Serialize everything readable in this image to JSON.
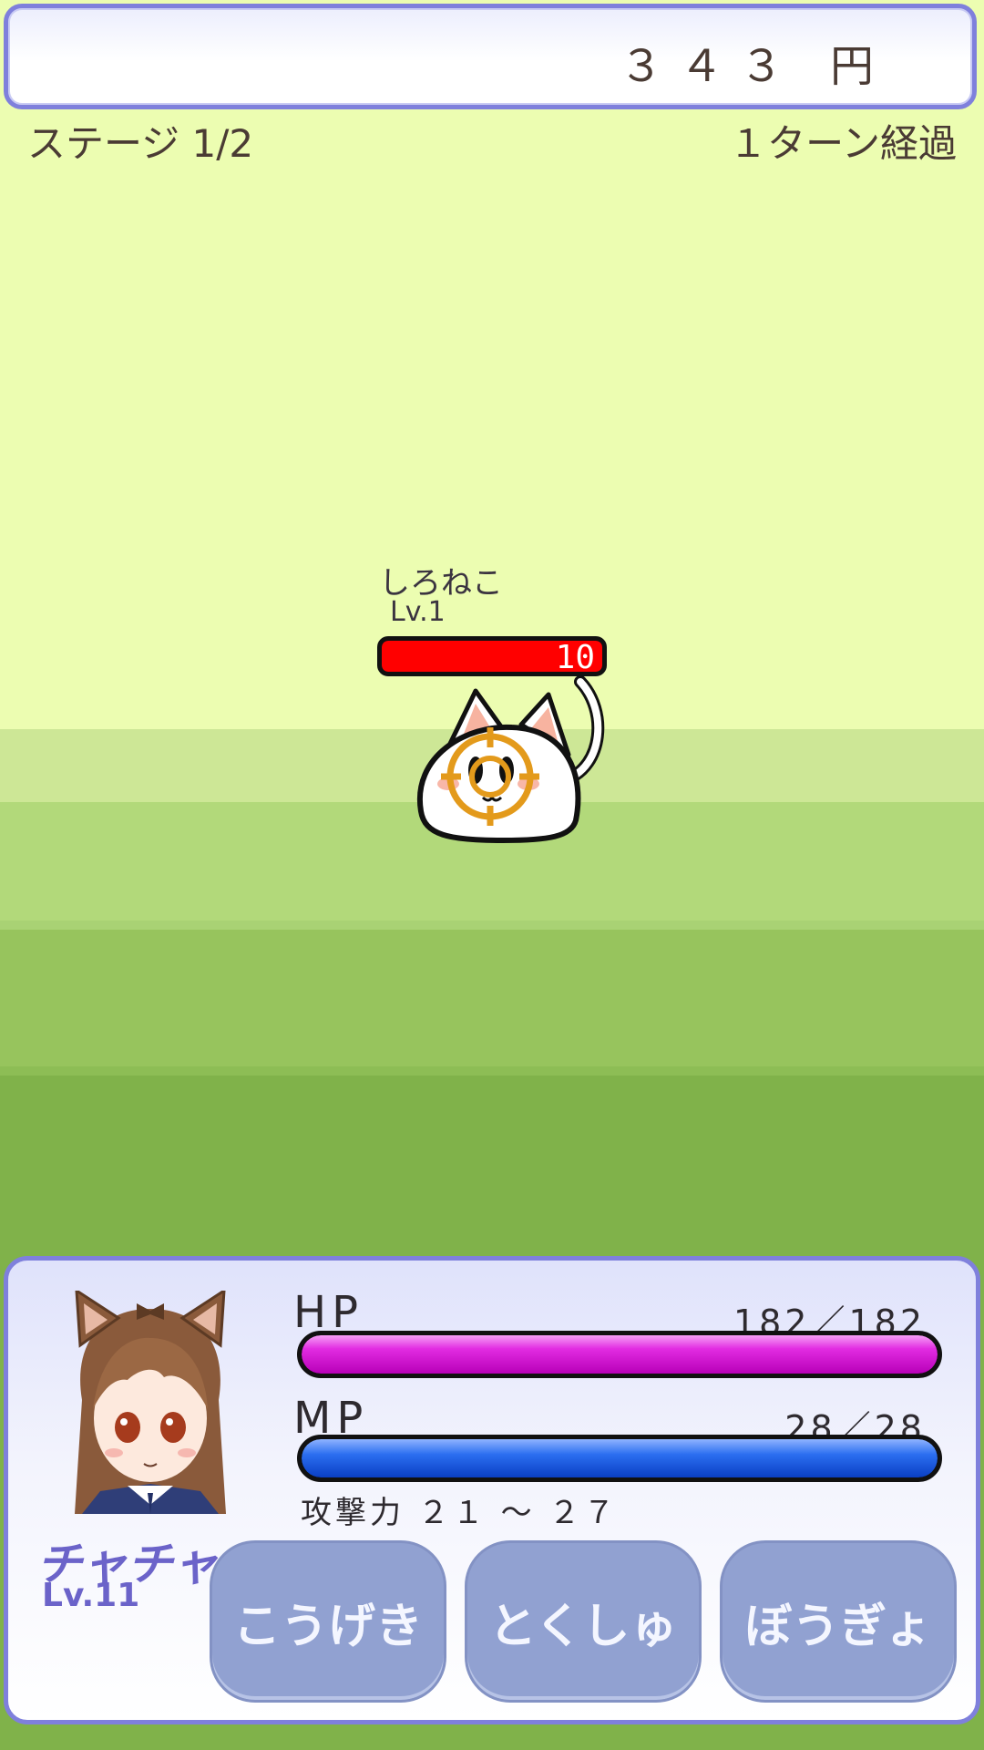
{
  "header": {
    "money": "３４３ 円",
    "stage": "ステージ 1/2",
    "turn": "１ターン経過"
  },
  "enemy": {
    "name": "しろねこ",
    "level": "Lv.1",
    "hp": "10",
    "hp_fraction": 1.0
  },
  "player": {
    "name": "チャチャ",
    "level": "Lv.11",
    "hp_label": "HP",
    "hp_value": "182／182",
    "hp_fraction": 1.0,
    "mp_label": "MP",
    "mp_value": "28／28",
    "mp_fraction": 1.0,
    "attack": "攻撃力 ２１ ～ ２７"
  },
  "commands": [
    "こうげき",
    "とくしゅ",
    "ぼうぎょ"
  ],
  "colors": {
    "enemy_hp": "#ff0000",
    "player_hp": "#e22ce2",
    "player_mp": "#2b6ef0",
    "panel_border": "#7f80dc",
    "button": "#91a1d1"
  }
}
